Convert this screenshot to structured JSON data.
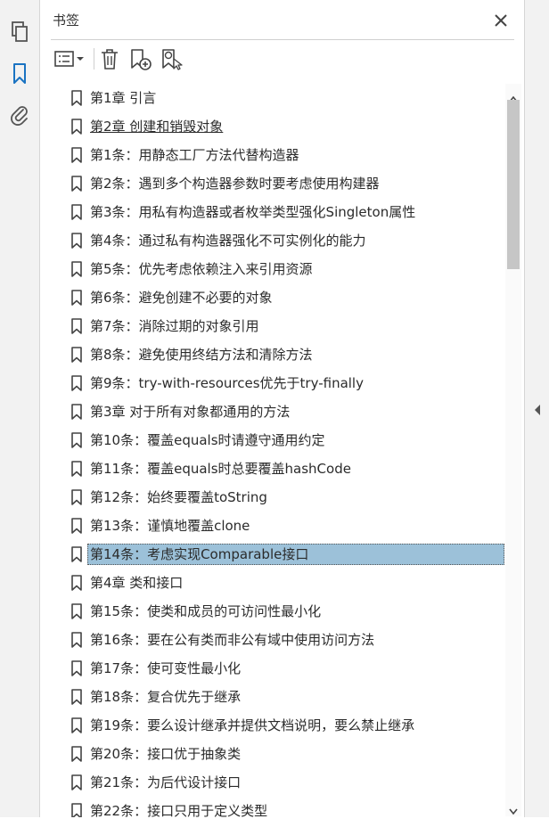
{
  "panel": {
    "title": "书签"
  },
  "rail_icons": [
    "pages-icon",
    "bookmark-icon",
    "attachment-icon"
  ],
  "toolbar_icons": [
    "options-menu-icon",
    "delete-icon",
    "new-bookmark-icon",
    "find-bookmark-icon"
  ],
  "accent_color": "#1a73c2",
  "selected_color": "#9cc1d9",
  "bookmarks": [
    {
      "label": "第1章 引言"
    },
    {
      "label": "第2章 创建和销毁对象"
    },
    {
      "label": "第1条：用静态工厂方法代替构造器"
    },
    {
      "label": "第2条：遇到多个构造器参数时要考虑使用构建器"
    },
    {
      "label": "第3条：用私有构造器或者枚举类型强化Singleton属性"
    },
    {
      "label": "第4条：通过私有构造器强化不可实例化的能力"
    },
    {
      "label": "第5条：优先考虑依赖注入来引用资源"
    },
    {
      "label": "第6条：避免创建不必要的对象"
    },
    {
      "label": "第7条：消除过期的对象引用"
    },
    {
      "label": "第8条：避免使用终结方法和清除方法"
    },
    {
      "label": "第9条：try-with-resources优先于try-finally"
    },
    {
      "label": "第3章 对于所有对象都通用的方法"
    },
    {
      "label": "第10条：覆盖equals时请遵守通用约定"
    },
    {
      "label": "第11条：覆盖equals时总要覆盖hashCode"
    },
    {
      "label": "第12条：始终要覆盖toString"
    },
    {
      "label": "第13条：谨慎地覆盖clone"
    },
    {
      "label": "第14条：考虑实现Comparable接口"
    },
    {
      "label": "第4章 类和接口"
    },
    {
      "label": "第15条：使类和成员的可访问性最小化"
    },
    {
      "label": "第16条：要在公有类而非公有域中使用访问方法"
    },
    {
      "label": "第17条：使可变性最小化"
    },
    {
      "label": "第18条：复合优先于继承"
    },
    {
      "label": "第19条：要么设计继承并提供文档说明，要么禁止继承"
    },
    {
      "label": "第20条：接口优于抽象类"
    },
    {
      "label": "第21条：为后代设计接口"
    },
    {
      "label": "第22条：接口只用于定义类型"
    }
  ]
}
